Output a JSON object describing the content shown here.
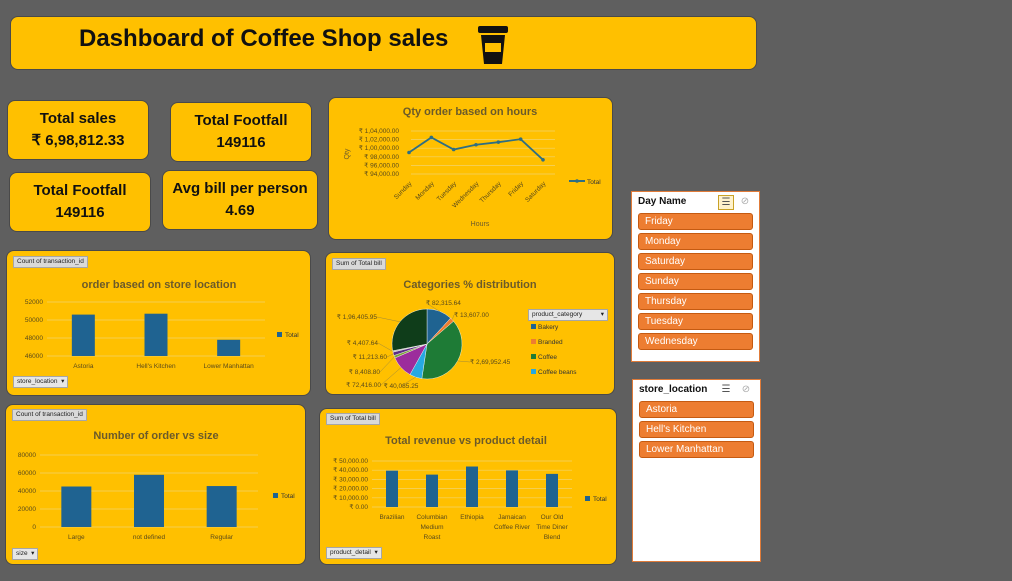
{
  "header": {
    "title": "Dashboard of Coffee Shop sales",
    "icon": "coffee-cup-icon"
  },
  "kpis": {
    "total_sales": {
      "label": "Total sales",
      "value": "₹ 6,98,812.33"
    },
    "total_footfall_1": {
      "label": "Total Footfall",
      "value": "149116"
    },
    "total_footfall_2": {
      "label": "Total Footfall",
      "value": "149116"
    },
    "avg_bill": {
      "label": "Avg bill per person",
      "value": "4.69"
    }
  },
  "charts": {
    "hours": {
      "ylabel": "Qty",
      "xlabel": "Hours",
      "legend": "Total"
    },
    "store": {
      "pill": "Count of transaction_id",
      "filter": "store_location",
      "legend": "Total"
    },
    "categories": {
      "pill": "Sum of Total bill",
      "filter": "product_category"
    },
    "size": {
      "pill": "Count of transaction_id",
      "filter": "size",
      "legend": "Total"
    },
    "product": {
      "pill": "Sum of Total bill",
      "filter": "product_detail",
      "legend": "Total"
    }
  },
  "slicers": {
    "day_name": {
      "title": "Day Name",
      "items": [
        "Friday",
        "Monday",
        "Saturday",
        "Sunday",
        "Thursday",
        "Tuesday",
        "Wednesday"
      ]
    },
    "store_location": {
      "title": "store_location",
      "items": [
        "Astoria",
        "Hell's Kitchen",
        "Lower Manhattan"
      ]
    }
  },
  "colors": {
    "background": "#5f5f5f",
    "card": "#ffc000",
    "bar": "#1f6391",
    "slicer_item": "#ed7d31",
    "line": "#2e6e83"
  },
  "chart_data": [
    {
      "type": "line",
      "title": "Qty order based on hours",
      "xlabel": "Hours",
      "ylabel": "Qty",
      "categories": [
        "Sunday",
        "Monday",
        "Tuesday",
        "Wednesday",
        "Thursday",
        "Friday",
        "Saturday"
      ],
      "series": [
        {
          "name": "Total",
          "values": [
            99000,
            102500,
            99700,
            100800,
            101400,
            102100,
            97300
          ]
        }
      ],
      "yticks": [
        "₹ 94,000.00",
        "₹ 96,000.00",
        "₹ 98,000.00",
        "₹ 1,00,000.00",
        "₹ 1,02,000.00",
        "₹ 1,04,000.00"
      ],
      "ylim": [
        94000,
        104000
      ],
      "legend": "right"
    },
    {
      "type": "bar",
      "title": "order based on store location",
      "categories": [
        "Astoria",
        "Hell's Kitchen",
        "Lower Manhattan"
      ],
      "series": [
        {
          "name": "Total",
          "values": [
            50600,
            50700,
            47800
          ]
        }
      ],
      "yticks": [
        "46000",
        "48000",
        "50000",
        "52000"
      ],
      "ylim": [
        46000,
        52000
      ],
      "legend": "right"
    },
    {
      "type": "pie",
      "title": "Categories % distribution",
      "legend_title": "product_category",
      "legend": [
        "Bakery",
        "Branded",
        "Coffee",
        "Coffee beans"
      ],
      "slices": [
        {
          "label": "₹ 82,315.64",
          "value": 82315.64,
          "color": "#1f6391"
        },
        {
          "label": "₹ 13,607.00",
          "value": 13607.0,
          "color": "#ed7d31"
        },
        {
          "label": "₹ 2,69,952.45",
          "value": 269952.45,
          "color": "#1e7b36"
        },
        {
          "label": "₹ 40,085.25",
          "value": 40085.25,
          "color": "#27a9e1"
        },
        {
          "label": "₹ 72,416.00",
          "value": 72416.0,
          "color": "#9c2c9c"
        },
        {
          "label": "₹ 8,408.80",
          "value": 8408.8,
          "color": "#7aa33a"
        },
        {
          "label": "₹ 11,213.60",
          "value": 11213.6,
          "color": "#5b2b85"
        },
        {
          "label": "₹ 4,407.64",
          "value": 4407.64,
          "color": "#b7b7b7"
        },
        {
          "label": "₹ 1,96,405.95",
          "value": 196405.95,
          "color": "#0f3d1a"
        }
      ]
    },
    {
      "type": "bar",
      "title": "Number of order vs size",
      "categories": [
        "Large",
        "not defined",
        "Regular"
      ],
      "series": [
        {
          "name": "Total",
          "values": [
            45000,
            58000,
            45500
          ]
        }
      ],
      "yticks": [
        "0",
        "20000",
        "40000",
        "60000",
        "80000"
      ],
      "ylim": [
        0,
        80000
      ],
      "legend": "right"
    },
    {
      "type": "bar",
      "title": "Total revenue vs product detail",
      "categories": [
        "Brazilian",
        "Columbian Medium Roast",
        "Ethiopia",
        "Jamaican Coffee River",
        "Our Old Time Diner Blend"
      ],
      "series": [
        {
          "name": "Total",
          "values": [
            39500,
            35200,
            44000,
            39800,
            36000
          ]
        }
      ],
      "yticks": [
        "₹ 0.00",
        "₹ 10,000.00",
        "₹ 20,000.00",
        "₹ 30,000.00",
        "₹ 40,000.00",
        "₹ 50,000.00"
      ],
      "ylim": [
        0,
        50000
      ],
      "legend": "right"
    }
  ]
}
